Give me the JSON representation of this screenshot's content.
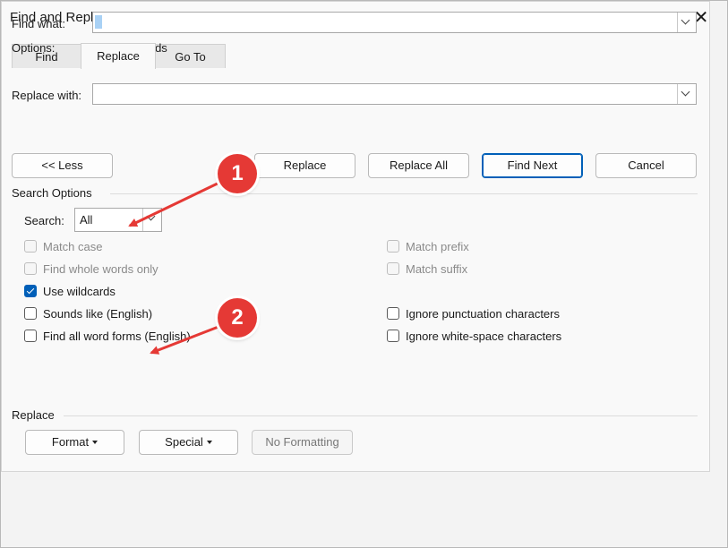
{
  "window": {
    "title": "Find and Replace",
    "help": "?",
    "close": "✕"
  },
  "tabs": [
    {
      "label": "Find",
      "active": false
    },
    {
      "label": "Replace",
      "active": true
    },
    {
      "label": "Go To",
      "active": false
    }
  ],
  "find_what": {
    "label": "Find what:",
    "value": ""
  },
  "options": {
    "label": "Options:",
    "value": "Use Wildcards"
  },
  "replace_with": {
    "label": "Replace with:",
    "value": ""
  },
  "buttons": {
    "less": "<< Less",
    "replace": "Replace",
    "replace_all": "Replace All",
    "find_next": "Find Next",
    "cancel": "Cancel"
  },
  "search_options": {
    "heading": "Search Options",
    "search_label": "Search:",
    "search_value": "All",
    "checkboxes_left": [
      {
        "label": "Match case",
        "checked": false,
        "enabled": false
      },
      {
        "label": "Find whole words only",
        "checked": false,
        "enabled": false
      },
      {
        "label": "Use wildcards",
        "checked": true,
        "enabled": true
      },
      {
        "label": "Sounds like (English)",
        "checked": false,
        "enabled": true
      },
      {
        "label": "Find all word forms (English)",
        "checked": false,
        "enabled": true
      }
    ],
    "checkboxes_right": [
      {
        "label": "Match prefix",
        "checked": false,
        "enabled": false
      },
      {
        "label": "Match suffix",
        "checked": false,
        "enabled": false
      },
      {
        "label": "Ignore punctuation characters",
        "checked": false,
        "enabled": true
      },
      {
        "label": "Ignore white-space characters",
        "checked": false,
        "enabled": true
      }
    ]
  },
  "replace_section": {
    "heading": "Replace",
    "format": "Format",
    "special": "Special",
    "no_formatting": "No Formatting"
  },
  "annotations": {
    "badge_1": "1",
    "badge_2": "2",
    "color": "#e53935"
  },
  "colors": {
    "accent": "#005fb8",
    "annotation": "#e53935"
  }
}
